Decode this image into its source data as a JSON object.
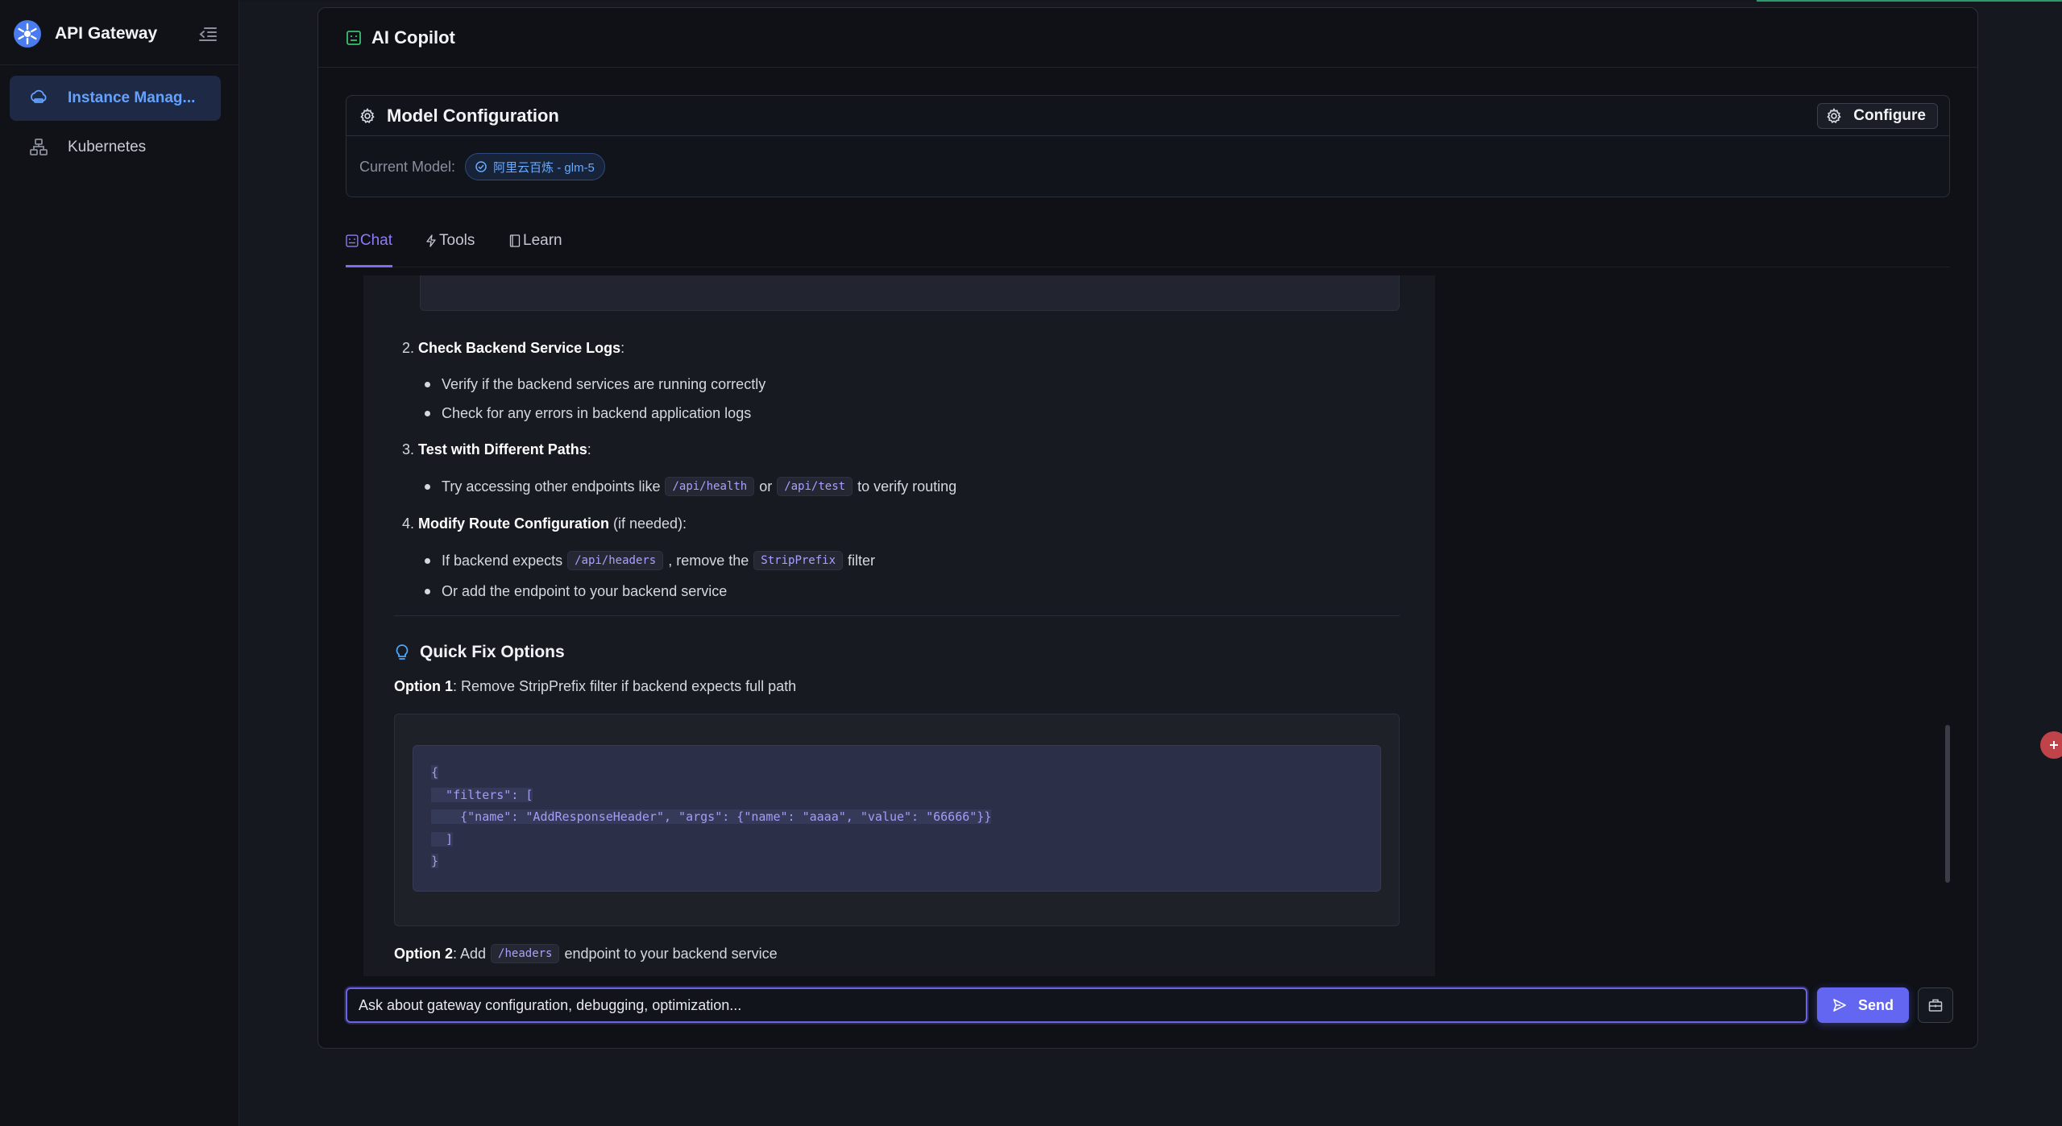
{
  "app": {
    "title": "API Gateway"
  },
  "sidebar": {
    "items": [
      {
        "label": "Instance Manag...",
        "icon": "cloud-server-icon",
        "active": true
      },
      {
        "label": "Kubernetes",
        "icon": "cluster-icon",
        "active": false
      }
    ]
  },
  "panel": {
    "title": "AI Copilot",
    "model_config": {
      "title": "Model Configuration",
      "configure_label": "Configure",
      "current_model_label": "Current Model:",
      "current_model_value": "阿里云百炼 - glm-5"
    },
    "tabs": [
      {
        "label": "Chat",
        "icon": "robot-icon",
        "active": true
      },
      {
        "label": "Tools",
        "icon": "lightning-icon",
        "active": false
      },
      {
        "label": "Learn",
        "icon": "book-icon",
        "active": false
      }
    ]
  },
  "message": {
    "step2": {
      "num": "2.",
      "title": "Check Backend Service Logs",
      "suffix": ":"
    },
    "step2_bullets": [
      "Verify if the backend services are running correctly",
      "Check for any errors in backend application logs"
    ],
    "step3": {
      "num": "3.",
      "title": "Test with Different Paths",
      "suffix": ":"
    },
    "step3_bullet": {
      "pre": "Try accessing other endpoints like",
      "code1": "/api/health",
      "mid": "or",
      "code2": "/api/test",
      "post": "to verify routing"
    },
    "step4": {
      "num": "4.",
      "title": "Modify Route Configuration",
      "suffix": " (if needed):"
    },
    "step4_bullet1": {
      "pre": "If backend expects",
      "code1": "/api/headers",
      "mid": ", remove the",
      "code2": "StripPrefix",
      "post": "filter"
    },
    "step4_bullet2": "Or add the endpoint to your backend service",
    "quick_fix_title": "Quick Fix Options",
    "option1": {
      "label": "Option 1",
      "text": ": Remove StripPrefix filter if backend expects full path"
    },
    "code_lines": [
      "{",
      "  \"filters\": [",
      "    {\"name\": \"AddResponseHeader\", \"args\": {\"name\": \"aaaa\", \"value\": \"66666\"}}",
      "  ]",
      "}"
    ],
    "option2": {
      "label": "Option 2",
      "pre": ": Add",
      "code": "/headers",
      "post": "endpoint to your backend service"
    }
  },
  "input": {
    "placeholder": "Ask about gateway configuration, debugging, optimization...",
    "send_label": "Send"
  },
  "colors": {
    "accent": "#6366f1",
    "active_nav": "#63a2ff",
    "tab_active": "#8b7cf6",
    "background": "#161820"
  }
}
